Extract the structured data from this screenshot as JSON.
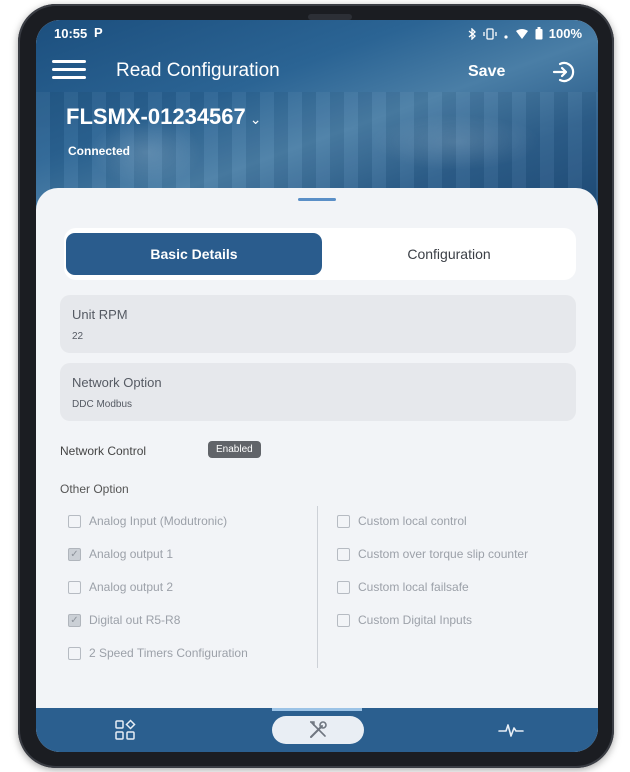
{
  "status_bar": {
    "time": "10:55",
    "app_glyph": "P",
    "battery": "100%",
    "icons": [
      "bluetooth-icon",
      "vibrate-icon",
      "signal-icon",
      "wifi-icon",
      "battery-icon"
    ]
  },
  "header": {
    "title": "Read Configuration",
    "save_label": "Save",
    "menu_icon": "hamburger-menu-icon",
    "logout_icon": "logout-icon"
  },
  "device": {
    "name": "FLSMX-01234567",
    "connection_status": "Connected"
  },
  "tabs": [
    {
      "label": "Basic Details",
      "active": true
    },
    {
      "label": "Configuration",
      "active": false
    }
  ],
  "fields": {
    "unit_rpm": {
      "label": "Unit RPM",
      "value": "22"
    },
    "network_option": {
      "label": "Network Option",
      "value": "DDC Modbus"
    }
  },
  "network_control": {
    "label": "Network Control",
    "badge": "Enabled"
  },
  "other_option": {
    "label": "Other Option",
    "left": [
      {
        "label": "Analog Input (Modutronic)",
        "checked": false
      },
      {
        "label": "Analog output 1",
        "checked": true
      },
      {
        "label": "Analog output 2",
        "checked": false
      },
      {
        "label": "Digital out R5-R8",
        "checked": true
      },
      {
        "label": "2 Speed Timers Configuration",
        "checked": false
      }
    ],
    "right": [
      {
        "label": "Custom local control",
        "checked": false
      },
      {
        "label": "Custom over torque slip counter",
        "checked": false
      },
      {
        "label": "Custom local failsafe",
        "checked": false
      },
      {
        "label": "Custom Digital Inputs",
        "checked": false
      }
    ]
  },
  "bottom_nav": {
    "items": [
      "grid-icon",
      "tools-icon",
      "pulse-icon"
    ],
    "active_index": 1
  },
  "colors": {
    "primary": "#2a5c8d",
    "sheet_bg": "#f2f4f7",
    "field_bg": "#e6e8ec",
    "badge_bg": "#616469"
  }
}
